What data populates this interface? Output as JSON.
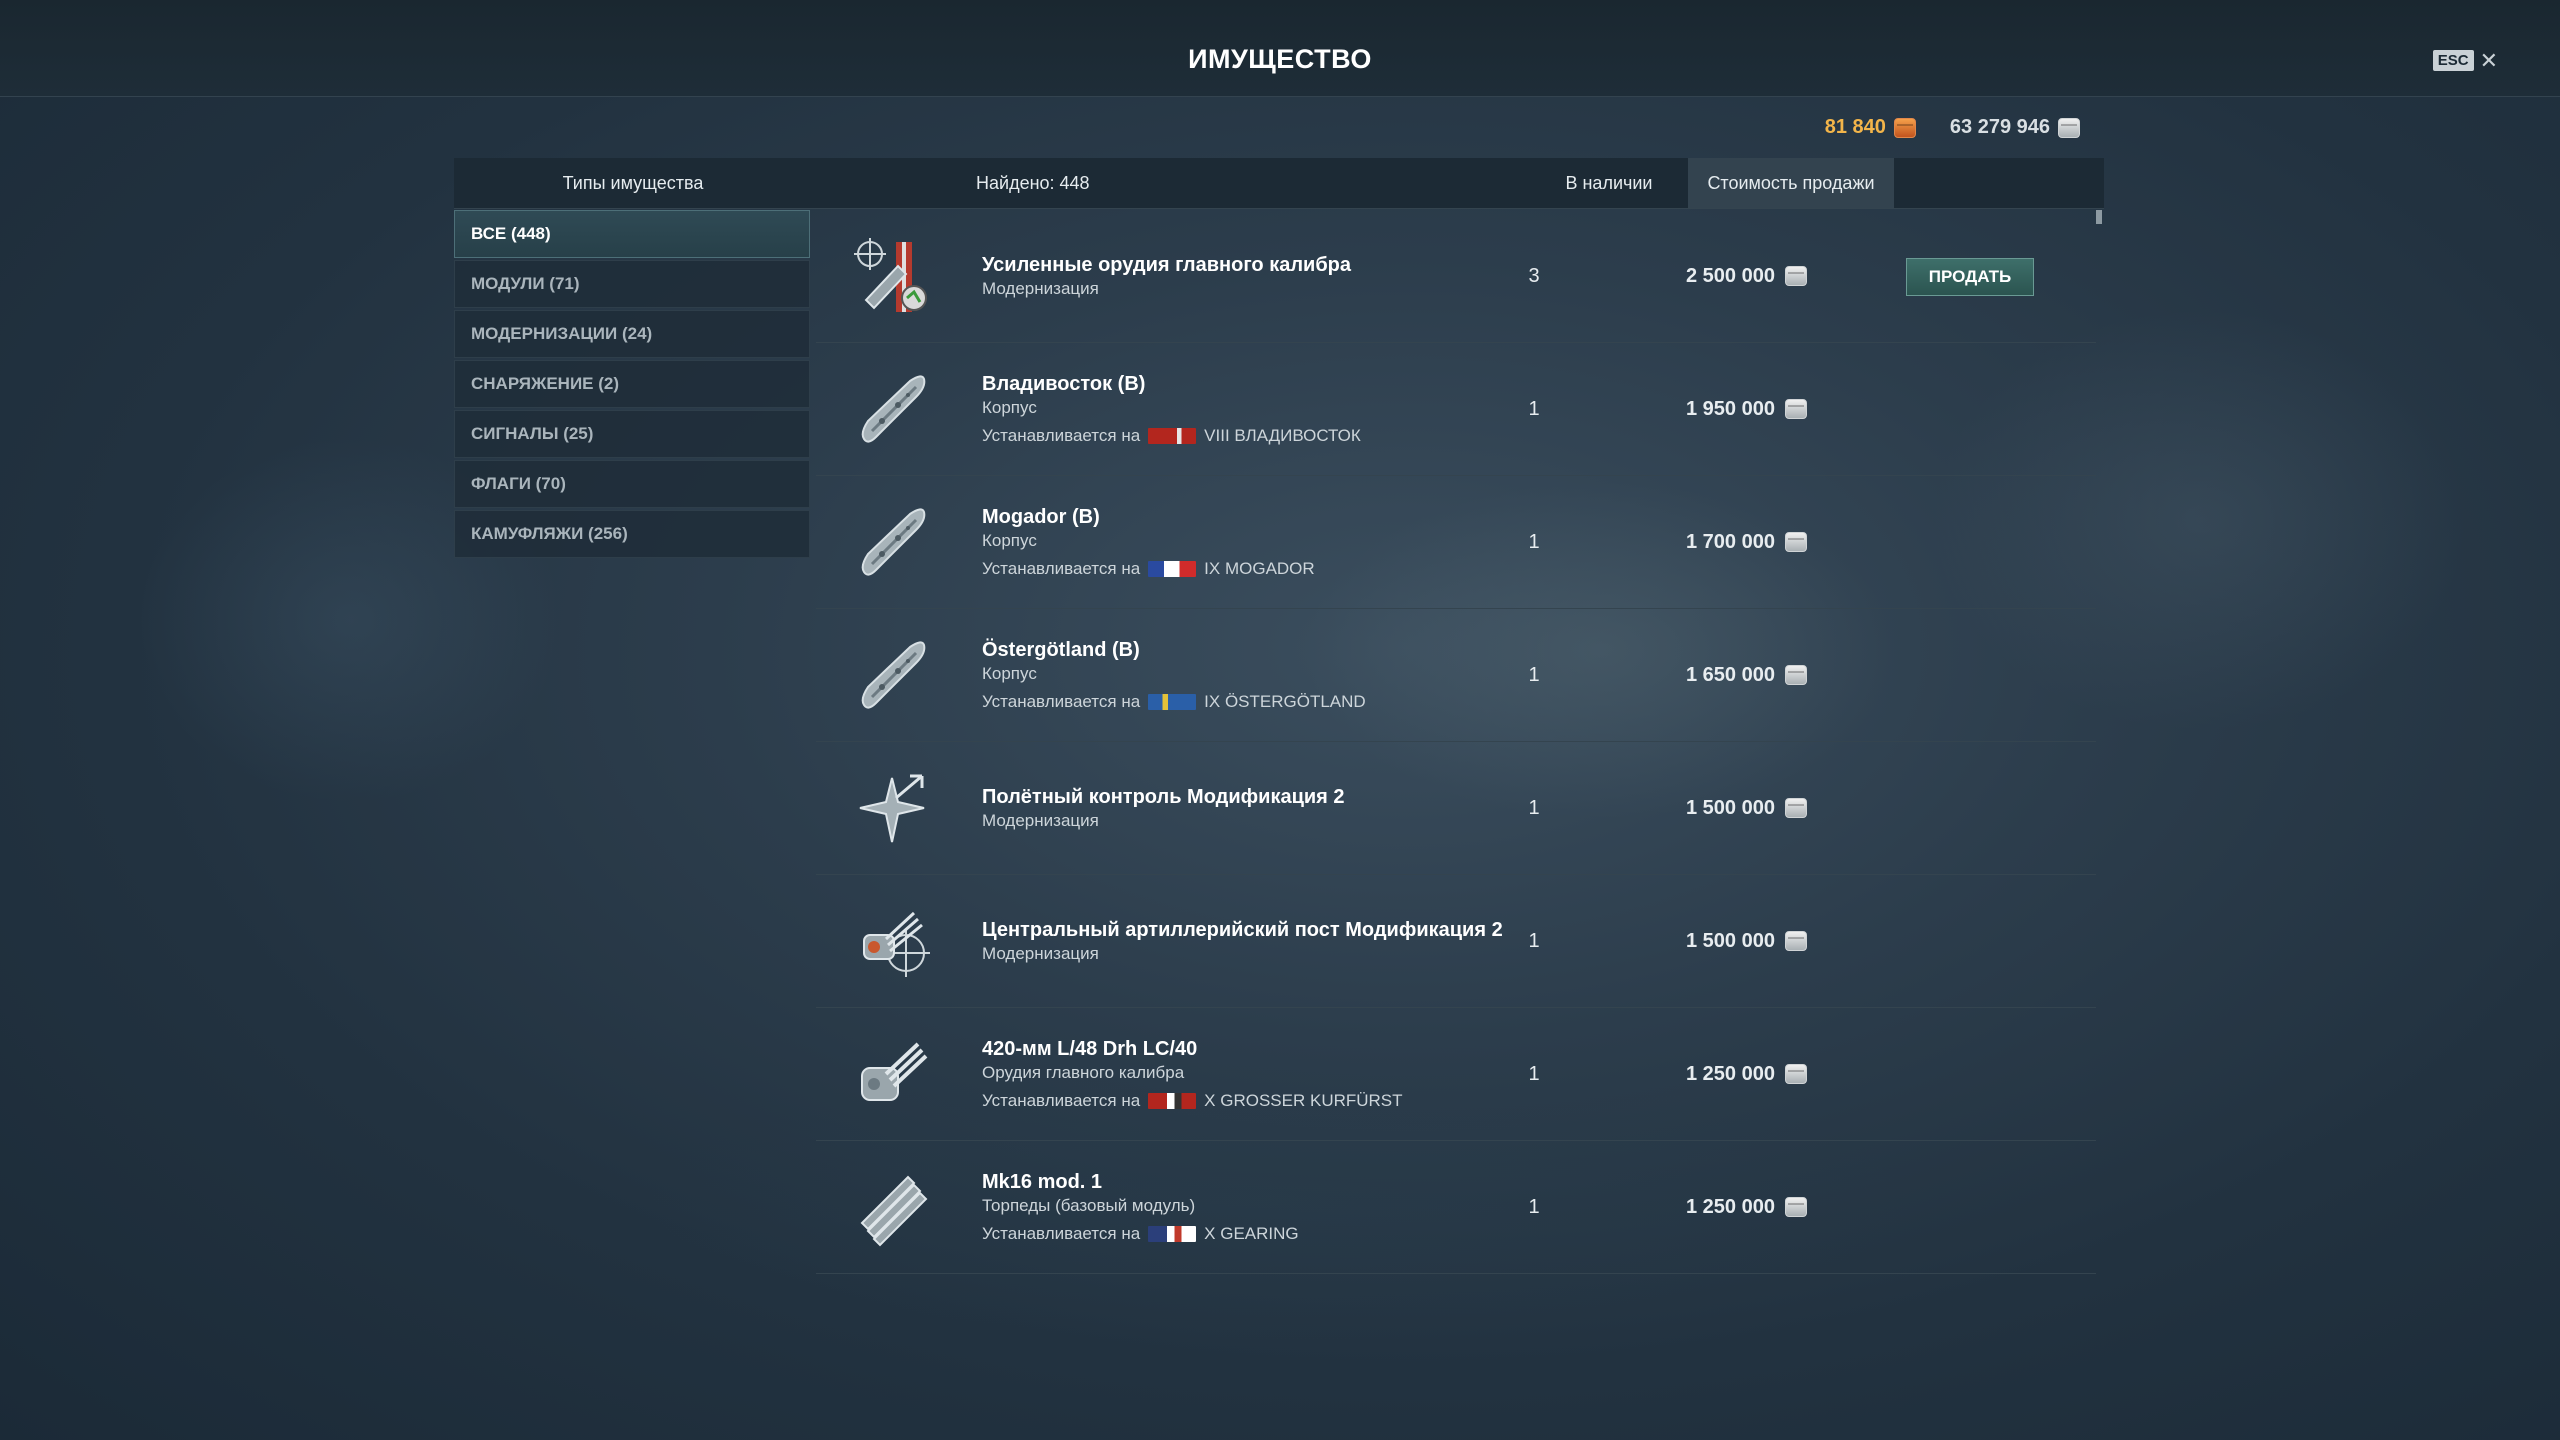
{
  "window": {
    "title": "ИМУЩЕСТВО",
    "esc_label": "ESC",
    "close_icon": "close-icon"
  },
  "balances": {
    "doubloons": "81 840",
    "credits": "63 279 946"
  },
  "header": {
    "types_label": "Типы имущества",
    "found_label": "Найдено: 448",
    "stock_label": "В наличии",
    "price_label": "Стоимость продажи"
  },
  "categories": [
    {
      "label": "ВСЕ (448)",
      "active": true
    },
    {
      "label": "МОДУЛИ (71)",
      "active": false
    },
    {
      "label": "МОДЕРНИЗАЦИИ (24)",
      "active": false
    },
    {
      "label": "СНАРЯЖЕНИЕ (2)",
      "active": false
    },
    {
      "label": "СИГНАЛЫ (25)",
      "active": false
    },
    {
      "label": "ФЛАГИ (70)",
      "active": false
    },
    {
      "label": "КАМУФЛЯЖИ (256)",
      "active": false
    }
  ],
  "items": [
    {
      "name": "Усиленные орудия главного калибра",
      "type": "Модернизация",
      "mount_label": "",
      "ship": "",
      "qty": "3",
      "price": "2 500 000",
      "icon": "main-battery-upgrade-icon",
      "sell_label": "ПРОДАТЬ"
    },
    {
      "name": "Владивосток (B)",
      "type": "Корпус",
      "mount_label": "Устанавливается на",
      "ship": "VIII ВЛАДИВОСТОК",
      "qty": "1",
      "price": "1 950 000",
      "icon": "hull-icon",
      "flag": "ussr"
    },
    {
      "name": "Mogador (B)",
      "type": "Корпус",
      "mount_label": "Устанавливается на",
      "ship": "IX MOGADOR",
      "qty": "1",
      "price": "1 700 000",
      "icon": "hull-icon",
      "flag": "france"
    },
    {
      "name": "Östergötland (B)",
      "type": "Корпус",
      "mount_label": "Устанавливается на",
      "ship": "IX ÖSTERGÖTLAND",
      "qty": "1",
      "price": "1 650 000",
      "icon": "hull-icon",
      "flag": "sweden"
    },
    {
      "name": "Полётный контроль Модификация 2",
      "type": "Модернизация",
      "mount_label": "",
      "ship": "",
      "qty": "1",
      "price": "1 500 000",
      "icon": "flight-control-icon"
    },
    {
      "name": "Центральный артиллерийский пост Модификация 2",
      "type": "Модернизация",
      "mount_label": "",
      "ship": "",
      "qty": "1",
      "price": "1 500 000",
      "icon": "artillery-post-icon"
    },
    {
      "name": "420-мм L/48 Drh LC/40",
      "type": "Орудия главного калибра",
      "mount_label": "Устанавливается на",
      "ship": "X GROSSER KURFÜRST",
      "qty": "1",
      "price": "1 250 000",
      "icon": "main-gun-icon",
      "flag": "germany"
    },
    {
      "name": "Mk16 mod. 1",
      "type": "Торпеды (базовый модуль)",
      "mount_label": "Устанавливается на",
      "ship": "X GEARING",
      "qty": "1",
      "price": "1 250 000",
      "icon": "torpedo-icon",
      "flag": "usa"
    }
  ],
  "colors": {
    "accent": "#3e6f6a",
    "doubloons": "#f3b54a",
    "text": "#ffffff"
  }
}
